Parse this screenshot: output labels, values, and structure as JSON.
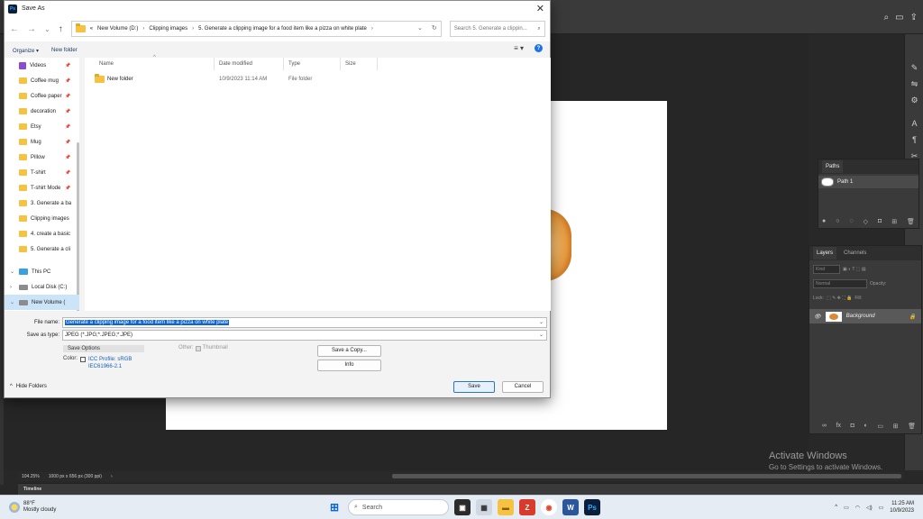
{
  "dialog": {
    "title": "Save As",
    "nav": {
      "back": "←",
      "forward": "→",
      "dropdown": "⌄",
      "up": "↑"
    },
    "breadcrumb": [
      "«",
      "New Volume (D:)",
      "Clipping images",
      "5. Generate a clipping image for a food item like a pizza on white plate"
    ],
    "breadcrumb_sep": "›",
    "search_placeholder": "Search 5. Generate a clippin...",
    "organize_label": "Organize ▾",
    "new_folder_label": "New folder",
    "view_icon": "≡ ▾",
    "help": "?",
    "sidebar": [
      {
        "label": "Videos",
        "icon": "video"
      },
      {
        "label": "Coffee mug",
        "icon": "folder"
      },
      {
        "label": "Coffee paper",
        "icon": "folder"
      },
      {
        "label": "decoration",
        "icon": "folder"
      },
      {
        "label": "Etsy",
        "icon": "folder"
      },
      {
        "label": "Mug",
        "icon": "folder"
      },
      {
        "label": "Pillow",
        "icon": "folder"
      },
      {
        "label": "T-shirt",
        "icon": "folder"
      },
      {
        "label": "T-shirt Mode",
        "icon": "folder"
      },
      {
        "label": "3. Generate a ba",
        "icon": "folder"
      },
      {
        "label": "Clipping images",
        "icon": "folder"
      },
      {
        "label": "4. create a basic",
        "icon": "folder"
      },
      {
        "label": "5. Generate a cli",
        "icon": "folder"
      }
    ],
    "this_pc": "This PC",
    "local_disk": "Local Disk (C:)",
    "new_volume": "New Volume (",
    "columns": [
      "Name",
      "Date modified",
      "Type",
      "Size"
    ],
    "files": [
      {
        "name": "New folder",
        "date": "10/9/2023 11:14 AM",
        "type": "File folder",
        "size": ""
      }
    ],
    "file_name_label": "File name:",
    "file_name_value": "Generate a clipping image for a food item like a pizza on white plate",
    "save_type_label": "Save as type:",
    "save_type_value": "JPEG (*.JPG;*.JPEG;*.JPE)",
    "save_options_label": "Save Options",
    "color_label": "Color:",
    "icc_line1": "ICC Profile:  sRGB",
    "icc_line2": "IEC61966-2.1",
    "other_label": "Other:",
    "thumbnail_label": "Thumbnail",
    "save_copy_label": "Save a Copy...",
    "info_label": "Info",
    "save_label": "Save",
    "cancel_label": "Cancel",
    "hide_folders_label": "Hide Folders"
  },
  "photoshop": {
    "paths_tab": "Paths",
    "path_name": "Path 1",
    "layers_tab": "Layers",
    "channels_tab": "Channels",
    "kind_label": "Kind",
    "blend_mode": "Normal",
    "opacity_label": "Opacity:",
    "lock_label": "Lock:",
    "fill_label": "Fill:",
    "layer_name": "Background",
    "zoom": "104.25%",
    "doc_info": "1000 px x 656 px (300 ppi)",
    "timeline_label": "Timeline",
    "activate_title": "Activate Windows",
    "activate_sub": "Go to Settings to activate Windows."
  },
  "taskbar": {
    "temp": "88°F",
    "weather": "Mostly cloudy",
    "search_label": "Search",
    "time": "11:25 AM",
    "date": "10/9/2023"
  }
}
